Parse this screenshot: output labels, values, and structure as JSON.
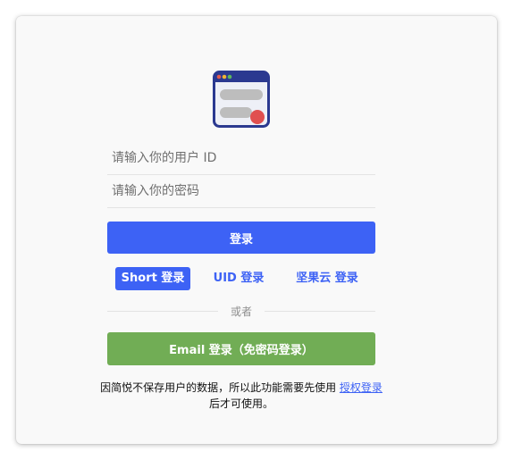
{
  "login": {
    "user_id_placeholder": "请输入你的用户 ID",
    "password_placeholder": "请输入你的密码",
    "submit_label": "登录"
  },
  "tabs": [
    {
      "label": "Short 登录",
      "active": true
    },
    {
      "label": "UID 登录",
      "active": false
    },
    {
      "label": "坚果云 登录",
      "active": false
    }
  ],
  "divider_text": "或者",
  "email_button_label": "Email 登录（免密码登录）",
  "notice": {
    "text_before": "因简悦不保存用户的数据，所以此功能需要先使用 ",
    "link_text": "授权登录",
    "text_after": " 后才可使用。"
  },
  "icons": {
    "logo": "app-window-logo-icon"
  },
  "colors": {
    "primary": "#3d62f5",
    "email": "#71ad55",
    "logo_frame": "#2b3990",
    "logo_dot": "#e04f4f"
  }
}
